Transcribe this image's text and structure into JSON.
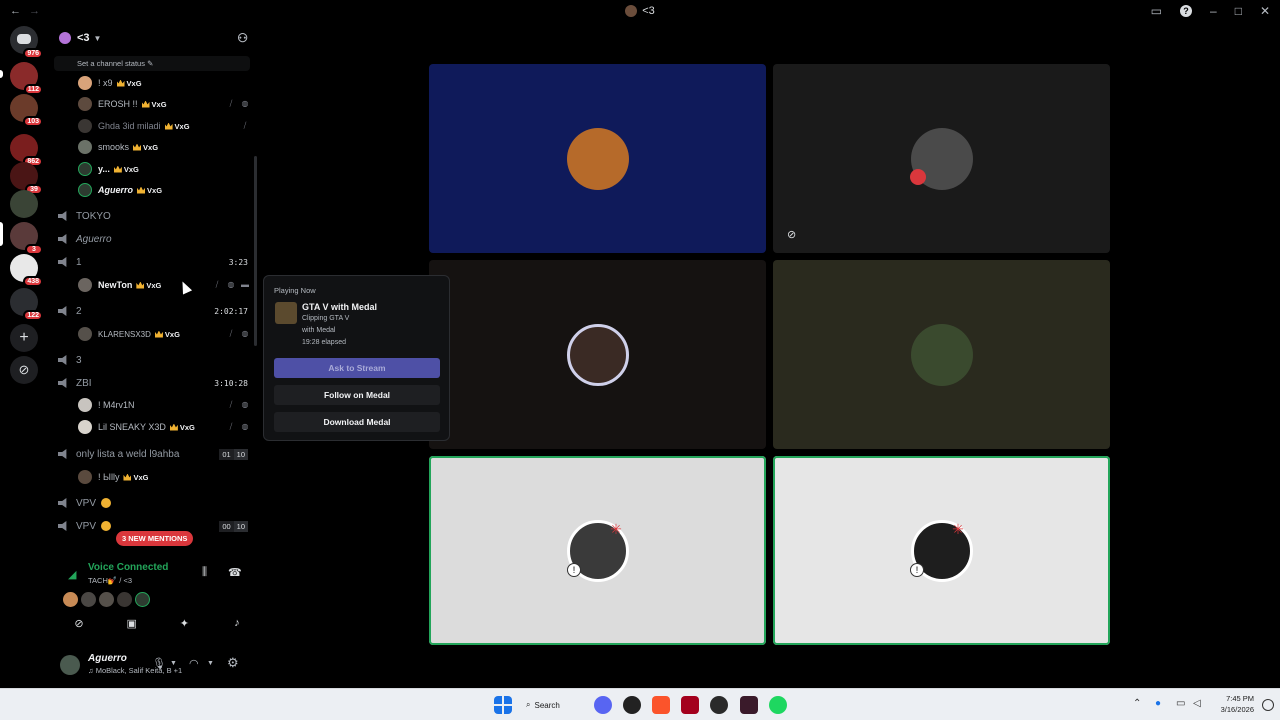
{
  "window": {
    "title": "<3",
    "back_glyph": "←",
    "forward_glyph": "→"
  },
  "rail": {
    "badges": [
      "976",
      "112",
      "103",
      "862",
      "39",
      "3",
      "438",
      "122"
    ]
  },
  "server": {
    "name": "<3",
    "channel_status_placeholder": "Set a channel status"
  },
  "members_top": [
    {
      "name": "! x9",
      "tag": "VxG",
      "style": "normal",
      "icons": []
    },
    {
      "name": "EROSH !!",
      "tag": "VxG",
      "style": "normal",
      "icons": [
        "mic-off",
        "deafen"
      ]
    },
    {
      "name": "Ghda 3id miladi",
      "tag": "VxG",
      "style": "normal",
      "icons": [
        "mic-off"
      ]
    },
    {
      "name": "smooks",
      "tag": "VxG",
      "style": "normal",
      "icons": []
    },
    {
      "name": "y...",
      "tag": "VxG",
      "style": "normal",
      "icons": []
    },
    {
      "name": "Aguerro",
      "tag": "VxG",
      "style": "italic",
      "icons": []
    }
  ],
  "channels": {
    "tokyo": {
      "name": "TOKYO"
    },
    "aguerro": {
      "name": "Aguerro"
    },
    "c1": {
      "name": "1",
      "time": "3:23"
    },
    "c2": {
      "name": "2",
      "time": "2:02:17"
    },
    "c3": {
      "name": "3"
    },
    "zbi": {
      "name": "ZBI",
      "time": "3:10:28"
    },
    "lista": {
      "name": "only lista a weld l9ahba",
      "limit_a": "01",
      "limit_b": "10"
    },
    "vpv1": {
      "name": "VPV"
    },
    "vpv2": {
      "name": "VPV",
      "limit_a": "00",
      "limit_b": "10"
    }
  },
  "members_c1": {
    "name": "NewTon",
    "tag": "VxG"
  },
  "members_c2": {
    "name": "KLARENSX3D",
    "tag": "VxG"
  },
  "members_zbi": [
    {
      "name": "! M4rv1N"
    },
    {
      "name": "Lil SNEAKY X3D",
      "tag": "VxG"
    }
  ],
  "members_lista": {
    "name": "! Ыlly",
    "tag": "VxG"
  },
  "mentions_pill": "3 NEW MENTIONS",
  "voice": {
    "status": "Voice Connected",
    "channel": "TACH💅 / <3"
  },
  "user": {
    "name": "Aguerro",
    "status": "♫ MoBlack, Salif Keita, B +1"
  },
  "popout": {
    "label": "Playing Now",
    "game": "GTA V with Medal",
    "line1": "Clipping GTA V",
    "line2": "with Medal",
    "elapsed": "19:28 elapsed",
    "ask_button": "Ask to Stream",
    "follow_button": "Follow on Medal",
    "download_button": "Download Medal"
  },
  "taskbar": {
    "search_label": "Search",
    "time": "7:45 PM",
    "date": "3/16/2026"
  },
  "colors": {
    "speaking": "#23a55a",
    "mention": "#da373c",
    "tile_blue": "#0f1a5a",
    "tile_dark": "#1a1a1a",
    "tile_olive": "#2a2a1e",
    "tile_light": "#dcdcdc"
  }
}
